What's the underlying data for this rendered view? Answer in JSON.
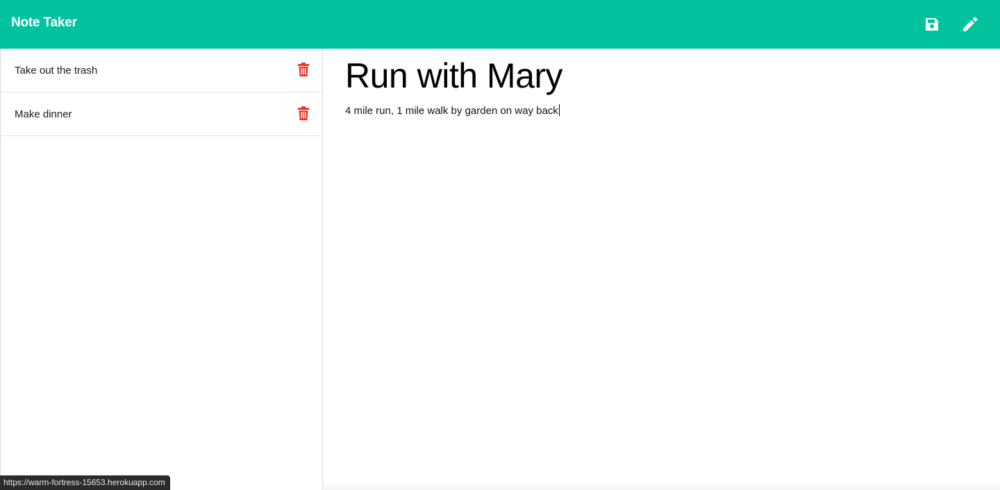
{
  "app": {
    "title": "Note Taker"
  },
  "toolbar": {
    "save_icon": "save-icon",
    "write_icon": "pencil-icon"
  },
  "notes": [
    {
      "title": "Take out the trash",
      "delete_icon": "trash-icon"
    },
    {
      "title": "Make dinner",
      "delete_icon": "trash-icon"
    }
  ],
  "editor": {
    "title": "Run with Mary",
    "body": "4 mile run, 1 mile walk by garden on way back"
  },
  "status_bar": {
    "url": "https://warm-fortress-15653.herokuapp.com"
  },
  "colors": {
    "navbar": "#00c39e",
    "delete": "#e8382a",
    "text": "#000000"
  }
}
